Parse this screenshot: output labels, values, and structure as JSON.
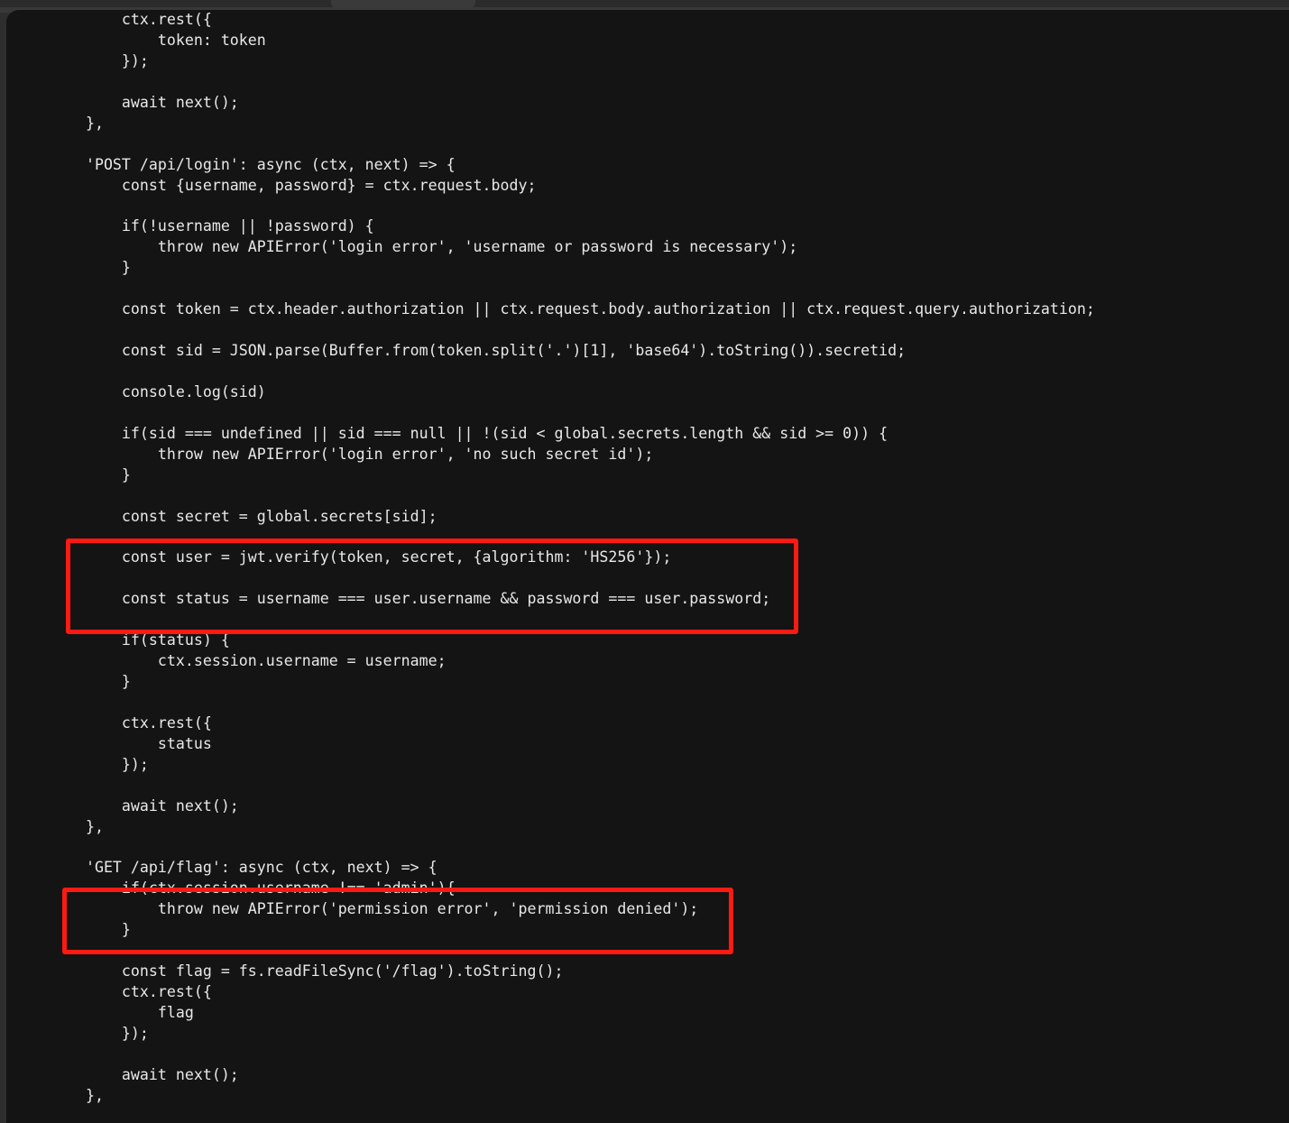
{
  "window": {
    "background_color": "#2e2e2e",
    "code_background_color": "#141414",
    "text_color": "#e8e8e8",
    "highlight_color": "#fc1a13"
  },
  "code": {
    "language": "javascript",
    "lines": [
      "        ctx.rest({",
      "            token: token",
      "        });",
      "",
      "        await next();",
      "    },",
      "",
      "    'POST /api/login': async (ctx, next) => {",
      "        const {username, password} = ctx.request.body;",
      "",
      "        if(!username || !password) {",
      "            throw new APIError('login error', 'username or password is necessary');",
      "        }",
      "",
      "        const token = ctx.header.authorization || ctx.request.body.authorization || ctx.request.query.authorization;",
      "",
      "        const sid = JSON.parse(Buffer.from(token.split('.')[1], 'base64').toString()).secretid;",
      "",
      "        console.log(sid)",
      "",
      "        if(sid === undefined || sid === null || !(sid < global.secrets.length && sid >= 0)) {",
      "            throw new APIError('login error', 'no such secret id');",
      "        }",
      "",
      "        const secret = global.secrets[sid];",
      "",
      "        const user = jwt.verify(token, secret, {algorithm: 'HS256'});",
      "",
      "        const status = username === user.username && password === user.password;",
      "",
      "        if(status) {",
      "            ctx.session.username = username;",
      "        }",
      "",
      "        ctx.rest({",
      "            status",
      "        });",
      "",
      "        await next();",
      "    },",
      "",
      "    'GET /api/flag': async (ctx, next) => {",
      "        if(ctx.session.username !== 'admin'){",
      "            throw new APIError('permission error', 'permission denied');",
      "        }",
      "",
      "        const flag = fs.readFileSync('/flag').toString();",
      "        ctx.rest({",
      "            flag",
      "        });",
      "",
      "        await next();",
      "    },"
    ]
  },
  "annotations": [
    {
      "id": "jwt-verify-highlight",
      "label": "const user = jwt.verify(token, secret, {algorithm: 'HS256'}); / const status = username === user.username && password === user.password;",
      "color": "#fc1a13"
    },
    {
      "id": "admin-permission-check-highlight",
      "label": "if(ctx.session.username !== 'admin'){ throw new APIError('permission error', 'permission denied'); }",
      "color": "#fc1a13"
    }
  ]
}
